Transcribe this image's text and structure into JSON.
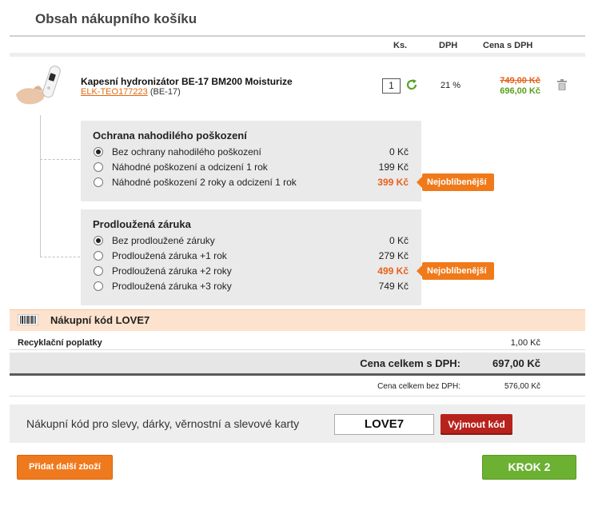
{
  "page": {
    "title": "Obsah nákupního košíku"
  },
  "table_header": {
    "qty": "Ks.",
    "vat": "DPH",
    "price": "Cena s DPH"
  },
  "product": {
    "name": "Kapesní hydronizátor BE-17 BM200 Moisturize",
    "code_link": "ELK-TEO177223",
    "code_suffix": "(BE-17)",
    "quantity": "1",
    "vat": "21 %",
    "price_old": "749,00 Kč",
    "price_new": "696,00 Kč"
  },
  "icons": {
    "product_image": "handheld-device-image",
    "refresh": "refresh-icon",
    "trash": "trash-icon",
    "barcode": "barcode-icon"
  },
  "options": [
    {
      "title": "Ochrana nahodilého poškození",
      "items": [
        {
          "label": "Bez ochrany nahodilého poškození",
          "price": "0 Kč",
          "selected": true
        },
        {
          "label": "Náhodné poškození a odcizení 1 rok",
          "price": "199 Kč",
          "selected": false
        },
        {
          "label": "Náhodné poškození 2 roky a odcizení 1 rok",
          "price": "399 Kč",
          "selected": false,
          "highlight": true
        }
      ]
    },
    {
      "title": "Prodloužená záruka",
      "items": [
        {
          "label": "Bez prodloužené záruky",
          "price": "0 Kč",
          "selected": true
        },
        {
          "label": "Prodloužená záruka +1 rok",
          "price": "279 Kč",
          "selected": false
        },
        {
          "label": "Prodloužená záruka +2 roky",
          "price": "499 Kč",
          "selected": false,
          "highlight": true
        },
        {
          "label": "Prodloužená záruka +3 roky",
          "price": "749 Kč",
          "selected": false
        }
      ]
    }
  ],
  "badges": {
    "popular": "Nejoblíbenější"
  },
  "promo": {
    "text": "Nákupní kód LOVE7"
  },
  "recycling": {
    "label": "Recyklační poplatky",
    "value": "1,00 Kč"
  },
  "totals": {
    "gross_label": "Cena celkem s DPH:",
    "gross_value": "697,00 Kč",
    "net_label": "Cena celkem bez DPH:",
    "net_value": "576,00 Kč"
  },
  "coupon": {
    "label": "Nákupní kód pro slevy, dárky, věrnostní a slevové karty",
    "value": "LOVE7",
    "remove_button": "Vyjmout kód"
  },
  "buttons": {
    "add_more": "Přidat další zboží",
    "next_step": "KROK 2"
  },
  "colors": {
    "accent_orange": "#f07a1a",
    "green": "#6cb132",
    "red": "#b8221c",
    "promo_bg": "#fde2cd"
  }
}
